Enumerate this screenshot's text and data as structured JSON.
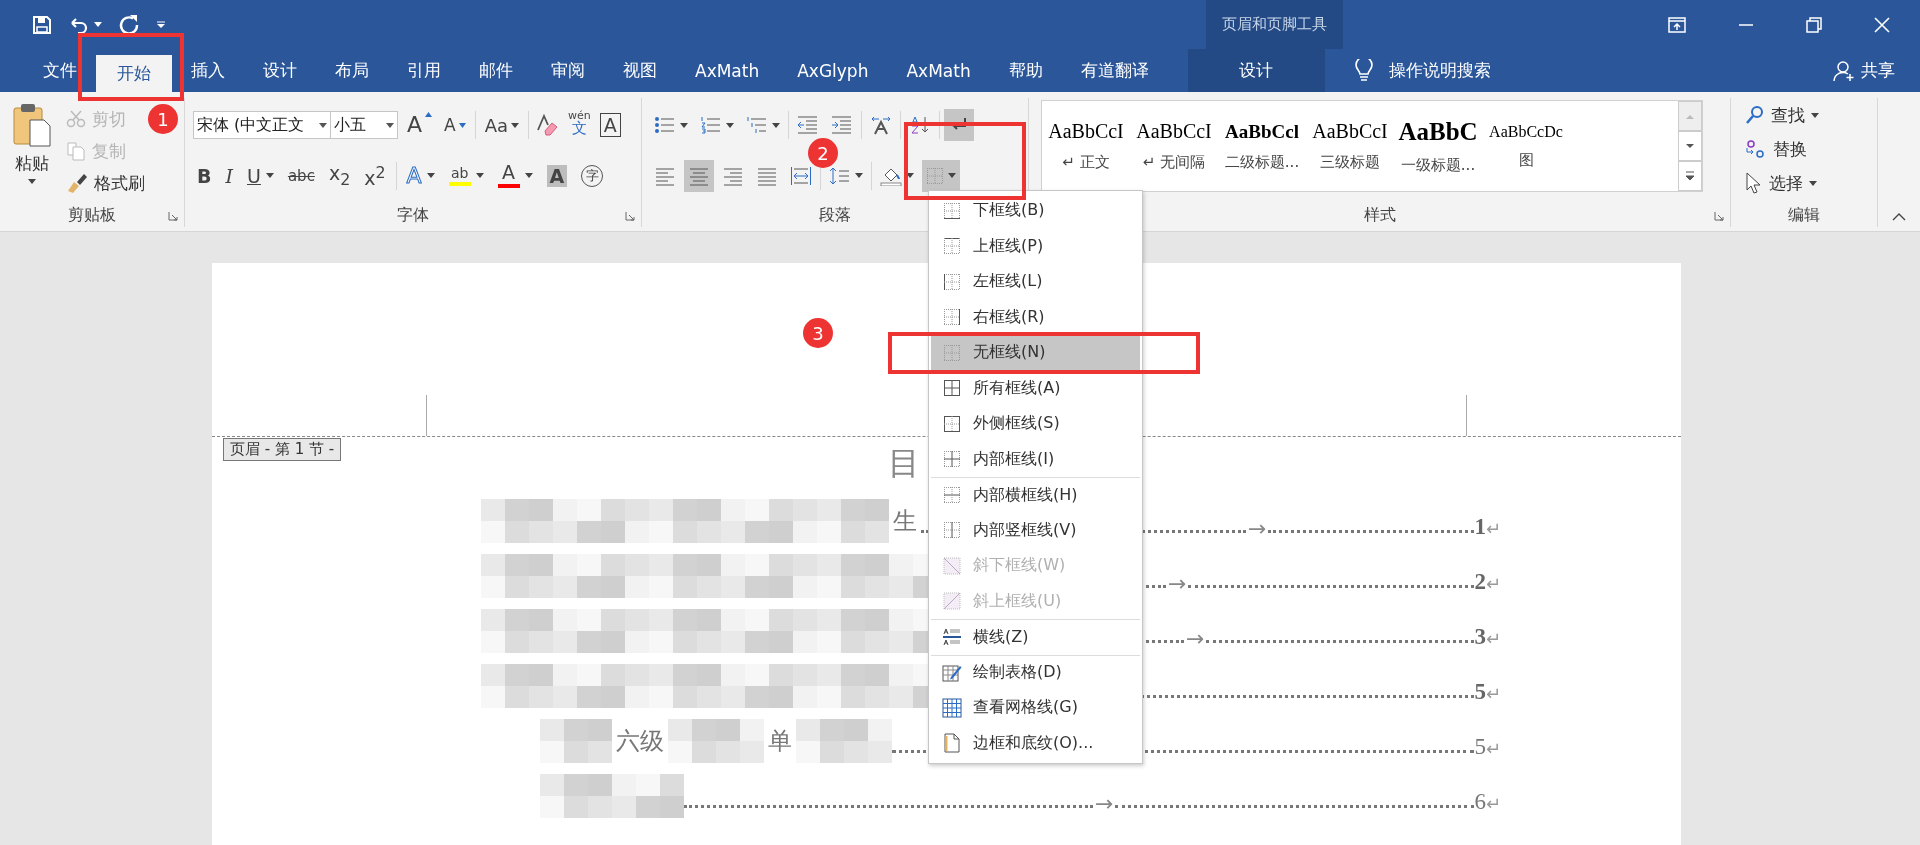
{
  "title_bar": {
    "contextual_title": "页眉和页脚工具"
  },
  "tabs": [
    {
      "label": "文件",
      "selected": false,
      "kind": "tab"
    },
    {
      "label": "开始",
      "selected": true,
      "kind": "tab"
    },
    {
      "label": "插入",
      "selected": false,
      "kind": "tab"
    },
    {
      "label": "设计",
      "selected": false,
      "kind": "tab"
    },
    {
      "label": "布局",
      "selected": false,
      "kind": "tab"
    },
    {
      "label": "引用",
      "selected": false,
      "kind": "tab"
    },
    {
      "label": "邮件",
      "selected": false,
      "kind": "tab"
    },
    {
      "label": "审阅",
      "selected": false,
      "kind": "tab"
    },
    {
      "label": "视图",
      "selected": false,
      "kind": "tab"
    },
    {
      "label": "AxMath",
      "selected": false,
      "kind": "tab"
    },
    {
      "label": "AxGlyph",
      "selected": false,
      "kind": "tab"
    },
    {
      "label": "AxMath",
      "selected": false,
      "kind": "tab"
    },
    {
      "label": "帮助",
      "selected": false,
      "kind": "tab"
    },
    {
      "label": "有道翻译",
      "selected": false,
      "kind": "tab"
    },
    {
      "label": "设计",
      "selected": false,
      "kind": "contextual"
    }
  ],
  "tell_me": {
    "label": "操作说明搜索"
  },
  "share": {
    "label": "共享"
  },
  "clipboard": {
    "title": "剪贴板",
    "paste": "粘贴",
    "items": [
      {
        "label": "剪切",
        "kind": "cut",
        "disabled": true
      },
      {
        "label": "复制",
        "kind": "copy",
        "disabled": true
      },
      {
        "label": "格式刷",
        "kind": "brush",
        "disabled": false
      }
    ]
  },
  "font": {
    "title": "字体",
    "font_name": "宋体 (中文正文",
    "font_size": "小五",
    "grow": "A",
    "shrink": "A",
    "case": "Aa",
    "phonetic": "wén",
    "phonetic_char": "文",
    "border_char": "A",
    "format": [
      {
        "glyph": "B",
        "kind": "bold",
        "caret": false
      },
      {
        "glyph": "I",
        "kind": "italic",
        "caret": false
      },
      {
        "glyph": "U",
        "kind": "underline",
        "caret": true
      },
      {
        "glyph": "abc",
        "kind": "strike",
        "caret": false
      },
      {
        "glyph": "x$_{2}$",
        "kind": "plain",
        "caret": false
      },
      {
        "glyph": "x$^{2}$",
        "kind": "plain",
        "caret": false
      },
      {
        "glyph": "A",
        "kind": "effects",
        "caret": true
      },
      {
        "glyph": "ab",
        "kind": "highlight",
        "color": "#ffff00",
        "caret": true
      },
      {
        "glyph": "A",
        "kind": "fontcolor",
        "color": "#ff0000",
        "caret": true
      },
      {
        "glyph": "A",
        "kind": "shading",
        "caret": false
      },
      {
        "glyph": "字",
        "kind": "enclose",
        "caret": false
      }
    ]
  },
  "paragraph": {
    "title": "段落",
    "row1": [
      {
        "kind": "bullets",
        "caret": true,
        "selected": false
      },
      {
        "kind": "numbering",
        "caret": true,
        "selected": false
      },
      {
        "kind": "multilevel",
        "caret": true,
        "selected": false
      },
      {
        "kind": "outdent",
        "caret": false,
        "selected": false
      },
      {
        "kind": "indent",
        "caret": false,
        "selected": false
      },
      {
        "kind": "direction",
        "caret": false,
        "selected": false
      },
      {
        "kind": "sort",
        "caret": false,
        "selected": false
      },
      {
        "kind": "marks",
        "caret": false,
        "selected": true
      }
    ],
    "row2": [
      {
        "kind": "align-left",
        "caret": false,
        "selected": false
      },
      {
        "kind": "align-center",
        "caret": false,
        "selected": true
      },
      {
        "kind": "align-right",
        "caret": false,
        "selected": false
      },
      {
        "kind": "justify",
        "caret": false,
        "selected": false
      },
      {
        "kind": "distribute",
        "caret": false,
        "selected": false
      },
      {
        "kind": "spacing",
        "caret": true,
        "selected": false
      },
      {
        "kind": "shading",
        "caret": true,
        "selected": false
      },
      {
        "kind": "borders",
        "caret": true,
        "selected": true
      }
    ]
  },
  "styles": {
    "title": "样式",
    "items": [
      {
        "preview": "AaBbCcI",
        "label": "↵ 正文",
        "kind": "plain"
      },
      {
        "preview": "AaBbCcI",
        "label": "↵ 无间隔",
        "kind": "plain"
      },
      {
        "preview": "AaBbCcl",
        "label": "二级标题...",
        "kind": "bold"
      },
      {
        "preview": "AaBbCcI",
        "label": "三级标题",
        "kind": "plain"
      },
      {
        "preview": "AaBbC",
        "label": "一级标题...",
        "kind": "large"
      },
      {
        "preview": "AaBbCcDc",
        "label": "图",
        "kind": "small"
      }
    ]
  },
  "editing": {
    "title": "编辑",
    "items": [
      {
        "label": "查找",
        "kind": "find",
        "caret": true
      },
      {
        "label": "替换",
        "kind": "replace",
        "caret": false
      },
      {
        "label": "选择",
        "kind": "select",
        "caret": true
      }
    ]
  },
  "document": {
    "header_tag": "页眉 - 第 1 节 -",
    "heading": "目",
    "toc": [
      {
        "segments": [
          {
            "kind": "mosaic"
          },
          {
            "kind": "text",
            "text": "生"
          }
        ],
        "tab_mark": "→",
        "page": "1",
        "bold": true,
        "mark": "↵"
      },
      {
        "segments": [
          {
            "kind": "mosaic"
          }
        ],
        "tab_mark": "→",
        "page": "2",
        "bold": true,
        "mark": "↵"
      },
      {
        "segments": [
          {
            "kind": "mosaic"
          }
        ],
        "tab_mark": "→",
        "page": "3",
        "bold": true,
        "mark": "↵"
      },
      {
        "segments": [
          {
            "kind": "mosaic"
          }
        ],
        "page": "5",
        "bold": true,
        "mark": "↵",
        "children": [
          {
            "segments": [
              {
                "kind": "mosaic"
              },
              {
                "kind": "text",
                "text": "六级"
              },
              {
                "kind": "mosaic"
              },
              {
                "kind": "text",
                "text": "单"
              },
              {
                "kind": "mosaic"
              }
            ],
            "page": "5",
            "bold": false,
            "mark": "↵"
          },
          {
            "segments": [
              {
                "kind": "mosaic"
              }
            ],
            "tab_mark": "→",
            "page": "6",
            "bold": false,
            "mark": "↵"
          }
        ]
      }
    ]
  },
  "border_menu": [
    {
      "label": "下框线(B)",
      "kind": "bottom",
      "disabled": false,
      "selected": false,
      "divider_above": false
    },
    {
      "label": "上框线(P)",
      "kind": "top",
      "disabled": false,
      "selected": false,
      "divider_above": false
    },
    {
      "label": "左框线(L)",
      "kind": "left",
      "disabled": false,
      "selected": false,
      "divider_above": false
    },
    {
      "label": "右框线(R)",
      "kind": "right",
      "disabled": false,
      "selected": false,
      "divider_above": false
    },
    {
      "label": "无框线(N)",
      "kind": "none",
      "disabled": false,
      "selected": true,
      "divider_above": false
    },
    {
      "label": "所有框线(A)",
      "kind": "all",
      "disabled": false,
      "selected": false,
      "divider_above": false
    },
    {
      "label": "外侧框线(S)",
      "kind": "outside",
      "disabled": false,
      "selected": false,
      "divider_above": false
    },
    {
      "label": "内部框线(I)",
      "kind": "inside",
      "disabled": false,
      "selected": false,
      "divider_above": false
    },
    {
      "label": "内部横框线(H)",
      "kind": "inside-h",
      "disabled": false,
      "selected": false,
      "divider_above": true
    },
    {
      "label": "内部竖框线(V)",
      "kind": "inside-v",
      "disabled": false,
      "selected": false,
      "divider_above": false
    },
    {
      "label": "斜下框线(W)",
      "kind": "diag-down",
      "disabled": true,
      "selected": false,
      "divider_above": false
    },
    {
      "label": "斜上框线(U)",
      "kind": "diag-up",
      "disabled": true,
      "selected": false,
      "divider_above": false
    },
    {
      "label": "横线(Z)",
      "kind": "hline",
      "disabled": false,
      "selected": false,
      "divider_above": true
    },
    {
      "label": "绘制表格(D)",
      "kind": "draw",
      "disabled": false,
      "selected": false,
      "divider_above": true
    },
    {
      "label": "查看网格线(G)",
      "kind": "grid",
      "disabled": false,
      "selected": false,
      "divider_above": false
    },
    {
      "label": "边框和底纹(O)...",
      "kind": "dialog",
      "disabled": false,
      "selected": false,
      "divider_above": false
    }
  ],
  "annotations": [
    {
      "number": "1"
    },
    {
      "number": "2"
    },
    {
      "number": "3"
    }
  ]
}
